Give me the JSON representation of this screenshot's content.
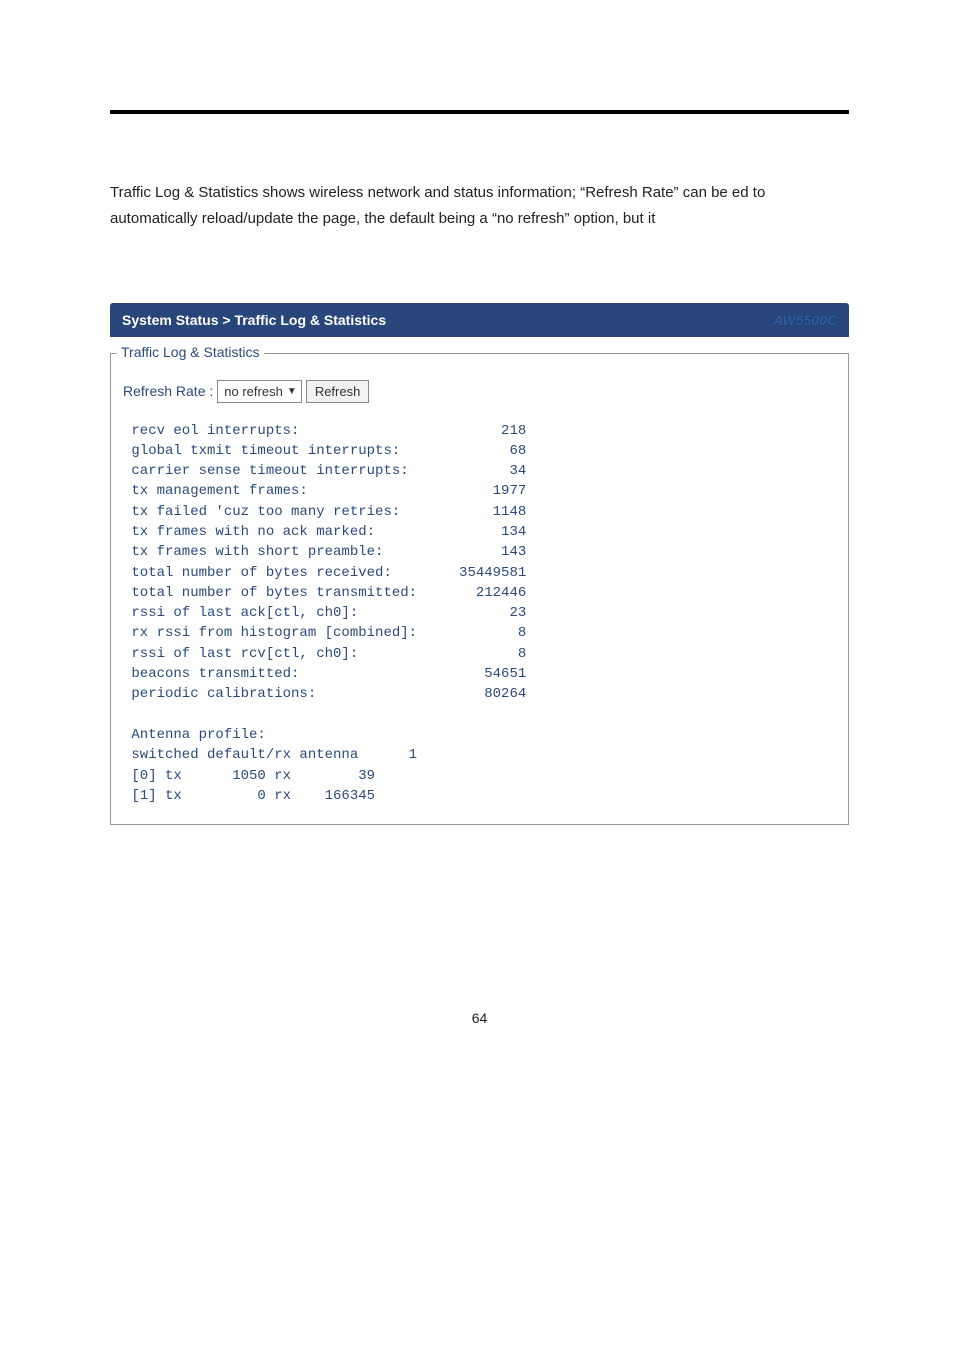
{
  "body_text": "Traffic Log & Statistics shows wireless network and status information; “Refresh Rate” can be ed to automatically reload/update the page, the default being a “no refresh” option, but it",
  "panel": {
    "breadcrumb": "System Status > Traffic Log & Statistics",
    "model": "AW5500C"
  },
  "fieldset_legend": "Traffic Log & Statistics",
  "refresh": {
    "label": "Refresh Rate :",
    "selected": "no refresh",
    "button": "Refresh"
  },
  "stats_block": " recv eol interrupts:                        218\n global txmit timeout interrupts:             68\n carrier sense timeout interrupts:            34\n tx management frames:                      1977\n tx failed 'cuz too many retries:           1148\n tx frames with no ack marked:               134\n tx frames with short preamble:              143\n total number of bytes received:        35449581\n total number of bytes transmitted:       212446\n rssi of last ack[ctl, ch0]:                  23\n rx rssi from histogram [combined]:            8\n rssi of last rcv[ctl, ch0]:                   8\n beacons transmitted:                      54651\n periodic calibrations:                    80264\n\n Antenna profile:\n switched default/rx antenna      1\n [0] tx      1050 rx        39\n [1] tx         0 rx    166345",
  "page_number": "64"
}
